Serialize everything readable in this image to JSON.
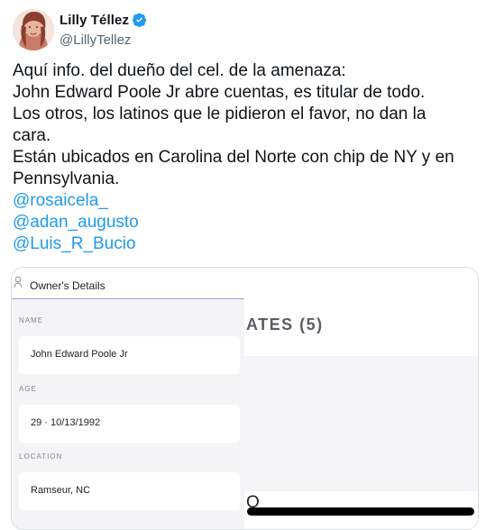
{
  "tweet": {
    "author": {
      "display_name": "Lilly Téllez",
      "handle": "@LillyTellez",
      "verified": true
    },
    "text_lines": [
      "Aquí info. del dueño del cel. de la amenaza:",
      "John Edward Poole Jr abre cuentas, es titular de todo.",
      "Los otros, los latinos que le pidieron el favor, no dan la",
      "cara.",
      "Están ubicados en Carolina del Norte con chip de NY y en",
      "Pennsylvania."
    ],
    "mentions": [
      "@rosaicela_",
      "@adan_augusto",
      "@Luis_R_Bucio"
    ]
  },
  "media": {
    "owner_details": {
      "title": "Owner's Details",
      "fields": [
        {
          "label": "NAME",
          "value": "John Edward Poole Jr"
        },
        {
          "label": "AGE",
          "value": "29 · 10/13/1992"
        },
        {
          "label": "LOCATION",
          "value": "Ramseur, NC"
        }
      ]
    },
    "right_panel": {
      "heading": "ATES (5)",
      "letter": "O"
    }
  },
  "icons": {
    "verified": "verified-badge-icon",
    "person": "person-icon"
  },
  "colors": {
    "link": "#1d9bf0",
    "verified": "#1d9bf0",
    "text": "#0f1419",
    "secondary_text": "#536471"
  }
}
